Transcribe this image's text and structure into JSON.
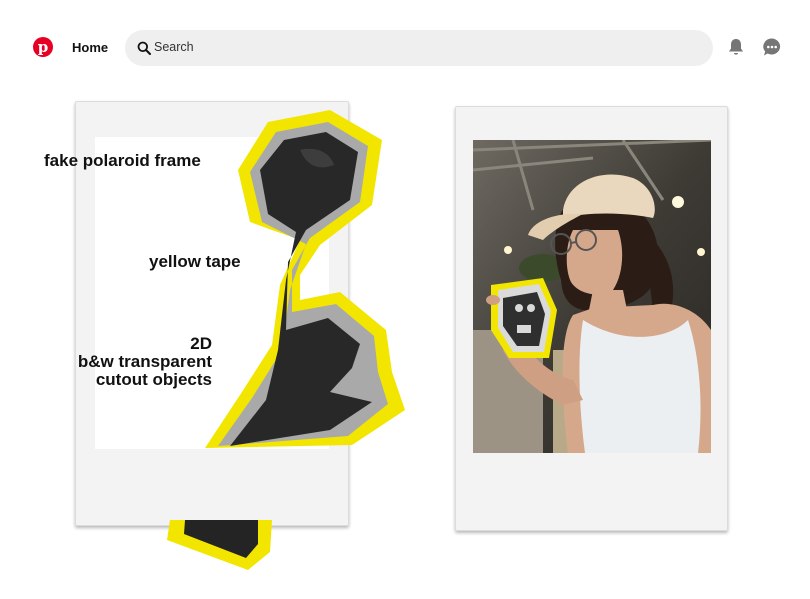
{
  "header": {
    "logo_letter": "p",
    "home_label": "Home",
    "search_placeholder": "Search"
  },
  "annotations": {
    "frame_label": "fake polaroid frame",
    "tape_label": "yellow tape",
    "cutout_line1": "2D",
    "cutout_line2": "b&w transparent",
    "cutout_line3": "cutout objects"
  },
  "icons": {
    "logo": "pinterest-logo-icon",
    "search": "search-icon",
    "notifications": "bell-icon",
    "messages": "chat-bubble-icon"
  },
  "colors": {
    "brand": "#e60023",
    "tape": "#f2e600",
    "search_bg": "#efefef"
  }
}
